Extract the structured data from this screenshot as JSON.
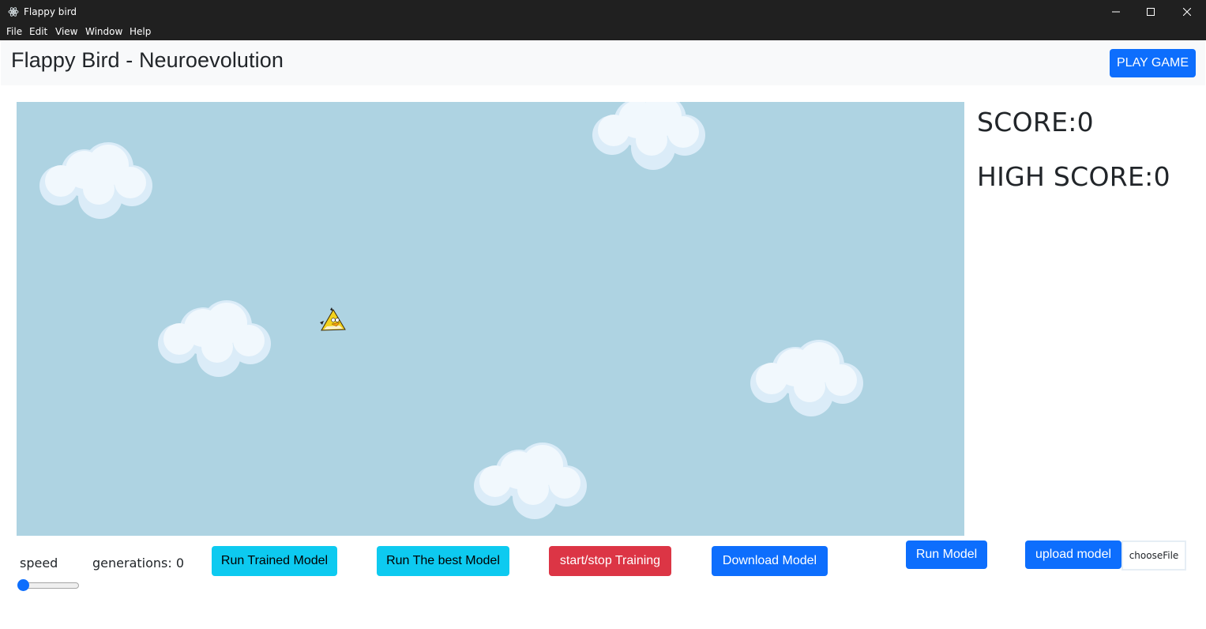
{
  "window": {
    "title": "Flappy bird"
  },
  "menu": [
    "File",
    "Edit",
    "View",
    "Window",
    "Help"
  ],
  "header": {
    "title": "Flappy Bird - Neuroevolution",
    "play_button": "PLAY GAME"
  },
  "scoreboard": {
    "score": "SCORE:0",
    "high_score": "HIGH SCORE:0"
  },
  "controls": {
    "speed_label": "speed",
    "speed_value": 0,
    "generations": "generations: 0",
    "run_trained": "Run Trained Model",
    "run_best": "Run The best Model",
    "start_stop": "start/stop Training",
    "download": "Download Model",
    "run_model": "Run Model",
    "upload": "upload model",
    "choose_file": "chooseFile"
  },
  "colors": {
    "sky": "#aed3e2",
    "primary": "#0d6efd",
    "info": "#0dcaf0",
    "danger": "#dc3545",
    "bird": "#f3d21d"
  }
}
